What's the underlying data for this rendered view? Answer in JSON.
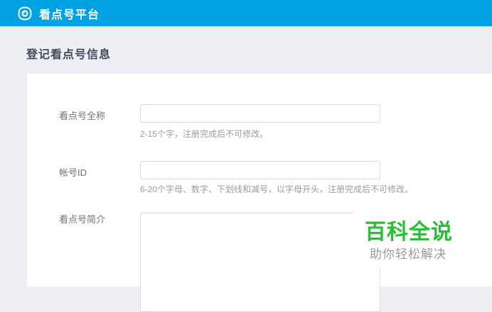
{
  "header": {
    "logo_icon": "eye-icon",
    "title": "看点号平台"
  },
  "page": {
    "heading": "登记看点号信息"
  },
  "form": {
    "fields": [
      {
        "label": "看点号全称",
        "value": "",
        "hint": "2-15个字，注册完成后不可修改。"
      },
      {
        "label": "帐号ID",
        "value": "",
        "hint": "6-20个字母、数字、下划线和减号，以字母开头，注册完成后不可修改。"
      },
      {
        "label": "看点号简介",
        "value": ""
      }
    ]
  },
  "watermark": {
    "title": "百科全说",
    "subtitle": "助你轻松解决"
  },
  "colors": {
    "header_bg": "#00a2e3",
    "page_bg": "#edeff4",
    "panel_bg": "#ffffff",
    "heading_text": "#3f4a5a",
    "label_text": "#6e737c",
    "hint_text": "#9b9b9b",
    "input_border": "#d9dce1",
    "watermark_green": "#22c230",
    "watermark_sub": "#9a9a9a"
  }
}
